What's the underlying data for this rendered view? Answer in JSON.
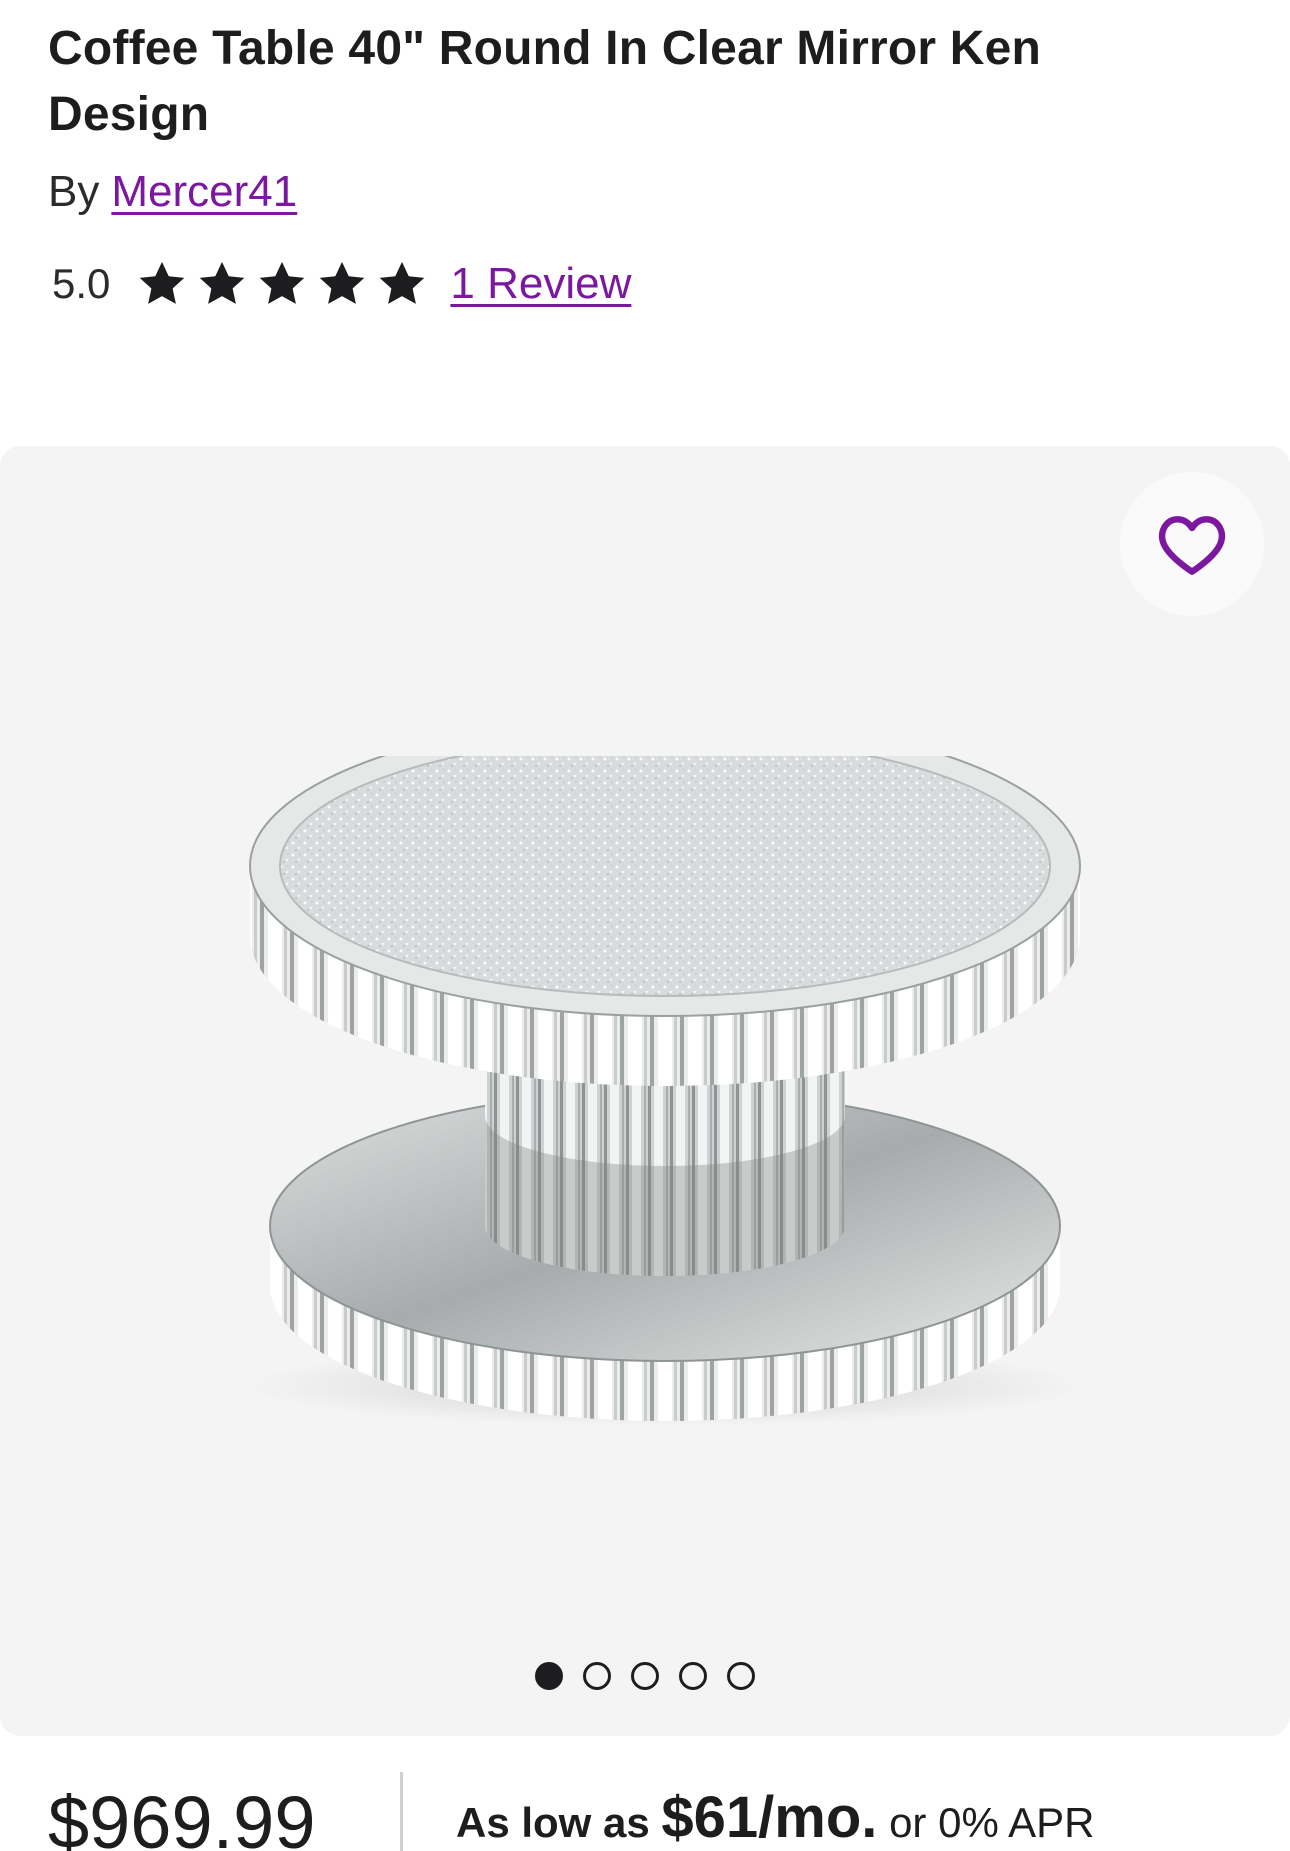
{
  "product": {
    "title": "Coffee Table 40\" Round In Clear Mirror Ken Design",
    "by_label": "By",
    "brand": "Mercer41",
    "rating_value": "5.0",
    "rating_stars": 5,
    "review_link": "1 Review"
  },
  "gallery": {
    "favorite_icon": "heart-outline-icon",
    "image_alt": "Round mirrored coffee table with crushed crystal top",
    "dots_total": 5,
    "active_dot": 1
  },
  "pricing": {
    "price": "$969.99",
    "financing_lead": "As low as ",
    "financing_amount": "$61/mo.",
    "financing_tail": " or 0% APR"
  },
  "colors": {
    "accent": "#7b189f",
    "text": "#1d1d1f",
    "gallery_bg": "#f4f4f4"
  }
}
